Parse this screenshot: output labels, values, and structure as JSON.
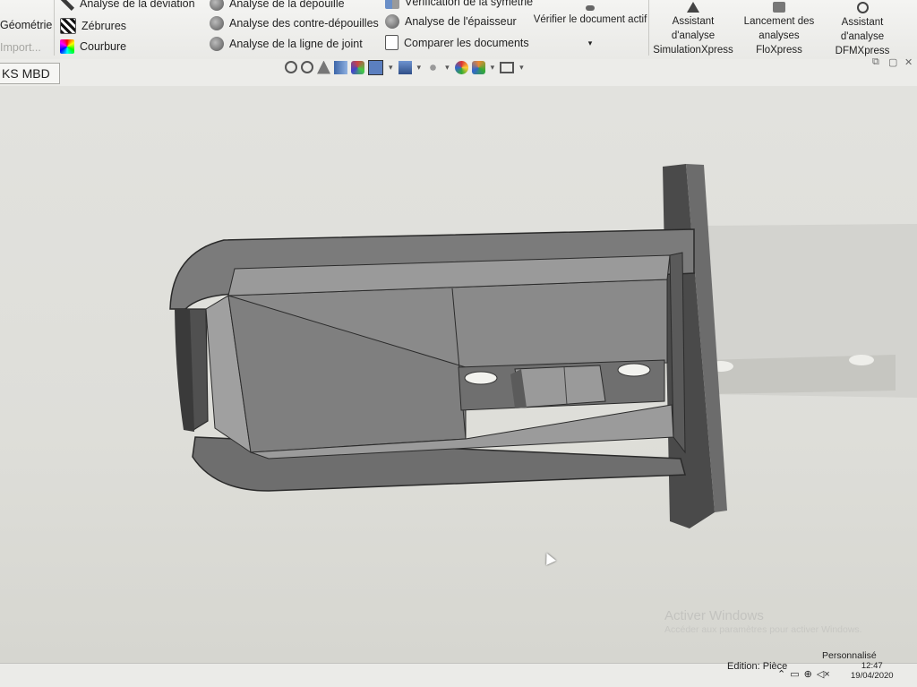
{
  "ribbon": {
    "col1": [
      "Géométrie",
      "Import..."
    ],
    "col2": [
      "Analyse de la déviation",
      "Zébrures",
      "Courbure"
    ],
    "col3": [
      "Analyse de la dépouille",
      "Analyse des contre-dépouilles",
      "Analyse de la ligne de joint"
    ],
    "col4": [
      "Vérification de la symétrie",
      "Analyse de l'épaisseur",
      "Comparer les documents"
    ],
    "verify": "Vérifier le document actif",
    "simxpress": [
      "Assistant d'analyse",
      "SimulationXpress"
    ],
    "floxpress": [
      "Lancement des",
      "analyses FloXpress"
    ],
    "dfmxpress": [
      "Assistant d'analyse",
      "DFMXpress"
    ]
  },
  "tabs": {
    "active": "KS MBD"
  },
  "watermark": {
    "title": "Activer Windows",
    "subtitle": "Accéder aux paramètres pour activer Windows."
  },
  "status": {
    "mode": "Edition: Pièce",
    "units": "Personnalisé",
    "time": "12:47",
    "date": "19/04/2020"
  },
  "colors": {
    "ribbon": "#f0f0ee",
    "viewport": "#dcdcd8",
    "model_body": "#8e8e8e",
    "model_dark": "#3c3c3c"
  }
}
